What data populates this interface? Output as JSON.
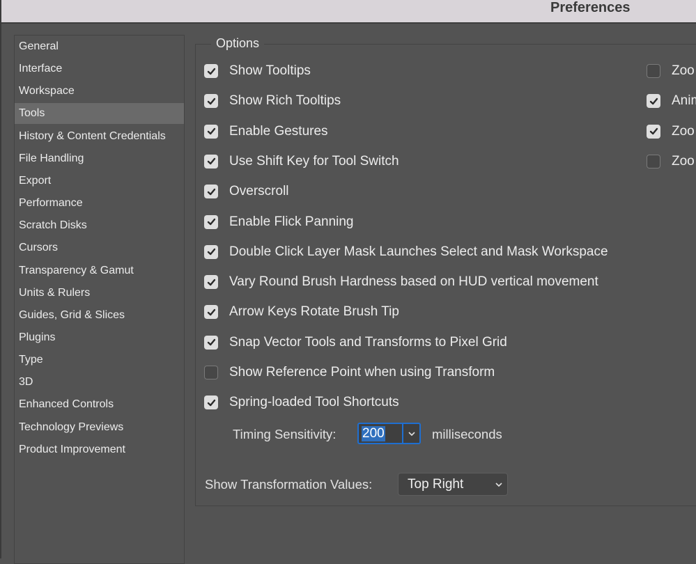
{
  "window": {
    "title": "Preferences"
  },
  "sidebar": {
    "selected_index": 3,
    "items": [
      {
        "label": "General"
      },
      {
        "label": "Interface"
      },
      {
        "label": "Workspace"
      },
      {
        "label": "Tools"
      },
      {
        "label": "History & Content Credentials"
      },
      {
        "label": "File Handling"
      },
      {
        "label": "Export"
      },
      {
        "label": "Performance"
      },
      {
        "label": "Scratch Disks"
      },
      {
        "label": "Cursors"
      },
      {
        "label": "Transparency & Gamut"
      },
      {
        "label": "Units & Rulers"
      },
      {
        "label": "Guides, Grid & Slices"
      },
      {
        "label": "Plugins"
      },
      {
        "label": "Type"
      },
      {
        "label": "3D"
      },
      {
        "label": "Enhanced Controls"
      },
      {
        "label": "Technology Previews"
      },
      {
        "label": "Product Improvement"
      }
    ]
  },
  "options": {
    "legend": "Options",
    "left_column": [
      {
        "label": "Show Tooltips",
        "checked": true
      },
      {
        "label": "Show Rich Tooltips",
        "checked": true
      },
      {
        "label": "Enable Gestures",
        "checked": true
      },
      {
        "label": "Use Shift Key for Tool Switch",
        "checked": true
      },
      {
        "label": "Overscroll",
        "checked": true
      },
      {
        "label": "Enable Flick Panning",
        "checked": true
      },
      {
        "label": "Double Click Layer Mask Launches Select and Mask Workspace",
        "checked": true
      },
      {
        "label": "Vary Round Brush Hardness based on HUD vertical movement",
        "checked": true
      },
      {
        "label": "Arrow Keys Rotate Brush Tip",
        "checked": true
      },
      {
        "label": "Snap Vector Tools and Transforms to Pixel Grid",
        "checked": true
      },
      {
        "label": "Show Reference Point when using Transform",
        "checked": false
      },
      {
        "label": "Spring-loaded Tool Shortcuts",
        "checked": true
      }
    ],
    "right_column": [
      {
        "label": "Zoo",
        "checked": false
      },
      {
        "label": "Anim",
        "checked": true
      },
      {
        "label": "Zoo",
        "checked": true
      },
      {
        "label": "Zoo",
        "checked": false
      }
    ],
    "timing_sensitivity": {
      "label": "Timing Sensitivity:",
      "value": "200",
      "units": "milliseconds"
    },
    "transformation_values": {
      "label": "Show Transformation Values:",
      "selected": "Top Right"
    }
  },
  "colors": {
    "accent": "#1f6fd1",
    "selection_highlight": "#2f6fbd",
    "panel_bg": "#535353",
    "selected_nav_bg": "#6a6a6a",
    "titlebar_bg": "#d9d4d9"
  }
}
